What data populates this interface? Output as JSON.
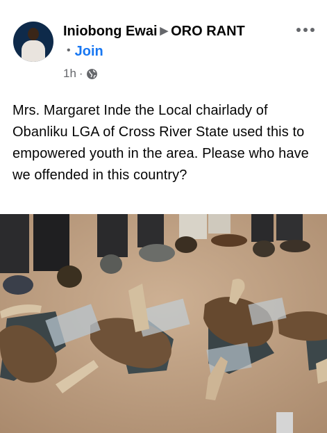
{
  "post": {
    "author_name": "Iniobong Ewai",
    "group_name": "ORO RANT",
    "join_label": "Join",
    "timestamp": "1h",
    "audience_icon": "globe-icon",
    "more_icon": "more-options-icon",
    "text": "Mrs. Margaret Inde the Local chairlady of Obanliku LGA of Cross River State used this to empowered youth in the area. Please who have we offended in this country?"
  },
  "colors": {
    "accent": "#1877f2",
    "text_primary": "#050505",
    "text_secondary": "#65676b",
    "background": "#ffffff"
  }
}
